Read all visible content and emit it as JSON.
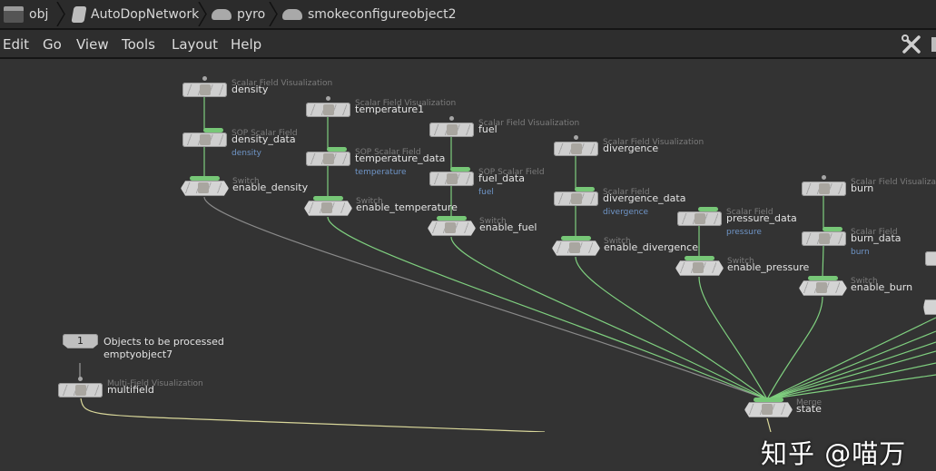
{
  "breadcrumb": [
    {
      "label": "obj",
      "icon": "clapperboard-icon"
    },
    {
      "label": "AutoDopNetwork",
      "icon": "dop-network-icon"
    },
    {
      "label": "pyro",
      "icon": "cloud-icon"
    },
    {
      "label": "smokeconfigureobject2",
      "icon": "cloud-icon"
    }
  ],
  "menu": [
    "Edit",
    "Go",
    "View",
    "Tools",
    "Layout",
    "Help"
  ],
  "toolbar": {
    "icon": "wrench-screwdriver-icon"
  },
  "colors": {
    "wire_green": "#7fcf7f",
    "wire_yellow": "#d9d79a",
    "wire_gray": "#8a8a8a",
    "flag_green": "#77c777",
    "comment_blue": "#6f95c7"
  },
  "nodes": [
    {
      "type": "Scalar Field Visualization",
      "name": "density"
    },
    {
      "type": "SOP Scalar Field",
      "name": "density_data",
      "comment": "density"
    },
    {
      "type": "Switch",
      "name": "enable_density"
    },
    {
      "type": "Scalar Field Visualization",
      "name": "temperature1"
    },
    {
      "type": "SOP Scalar Field",
      "name": "temperature_data",
      "comment": "temperature"
    },
    {
      "type": "Switch",
      "name": "enable_temperature"
    },
    {
      "type": "Scalar Field Visualization",
      "name": "fuel"
    },
    {
      "type": "SOP Scalar Field",
      "name": "fuel_data",
      "comment": "fuel"
    },
    {
      "type": "Switch",
      "name": "enable_fuel"
    },
    {
      "type": "Scalar Field Visualization",
      "name": "divergence"
    },
    {
      "type": "Scalar Field",
      "name": "divergence_data",
      "comment": "divergence"
    },
    {
      "type": "Switch",
      "name": "enable_divergence"
    },
    {
      "type": "Scalar Field",
      "name": "pressure_data",
      "comment": "pressure"
    },
    {
      "type": "Switch",
      "name": "enable_pressure"
    },
    {
      "type": "Scalar Field Visualization",
      "name": "burn"
    },
    {
      "type": "Scalar Field",
      "name": "burn_data",
      "comment": "burn"
    },
    {
      "type": "Switch",
      "name": "enable_burn"
    },
    {
      "type": "Multi-Field Visualization",
      "name": "multifield"
    },
    {
      "type": "Merge",
      "name": "state"
    }
  ],
  "input_node": {
    "index": "1",
    "label": "Objects to be processed",
    "name": "emptyobject7"
  },
  "watermark": "知乎 @喵万"
}
